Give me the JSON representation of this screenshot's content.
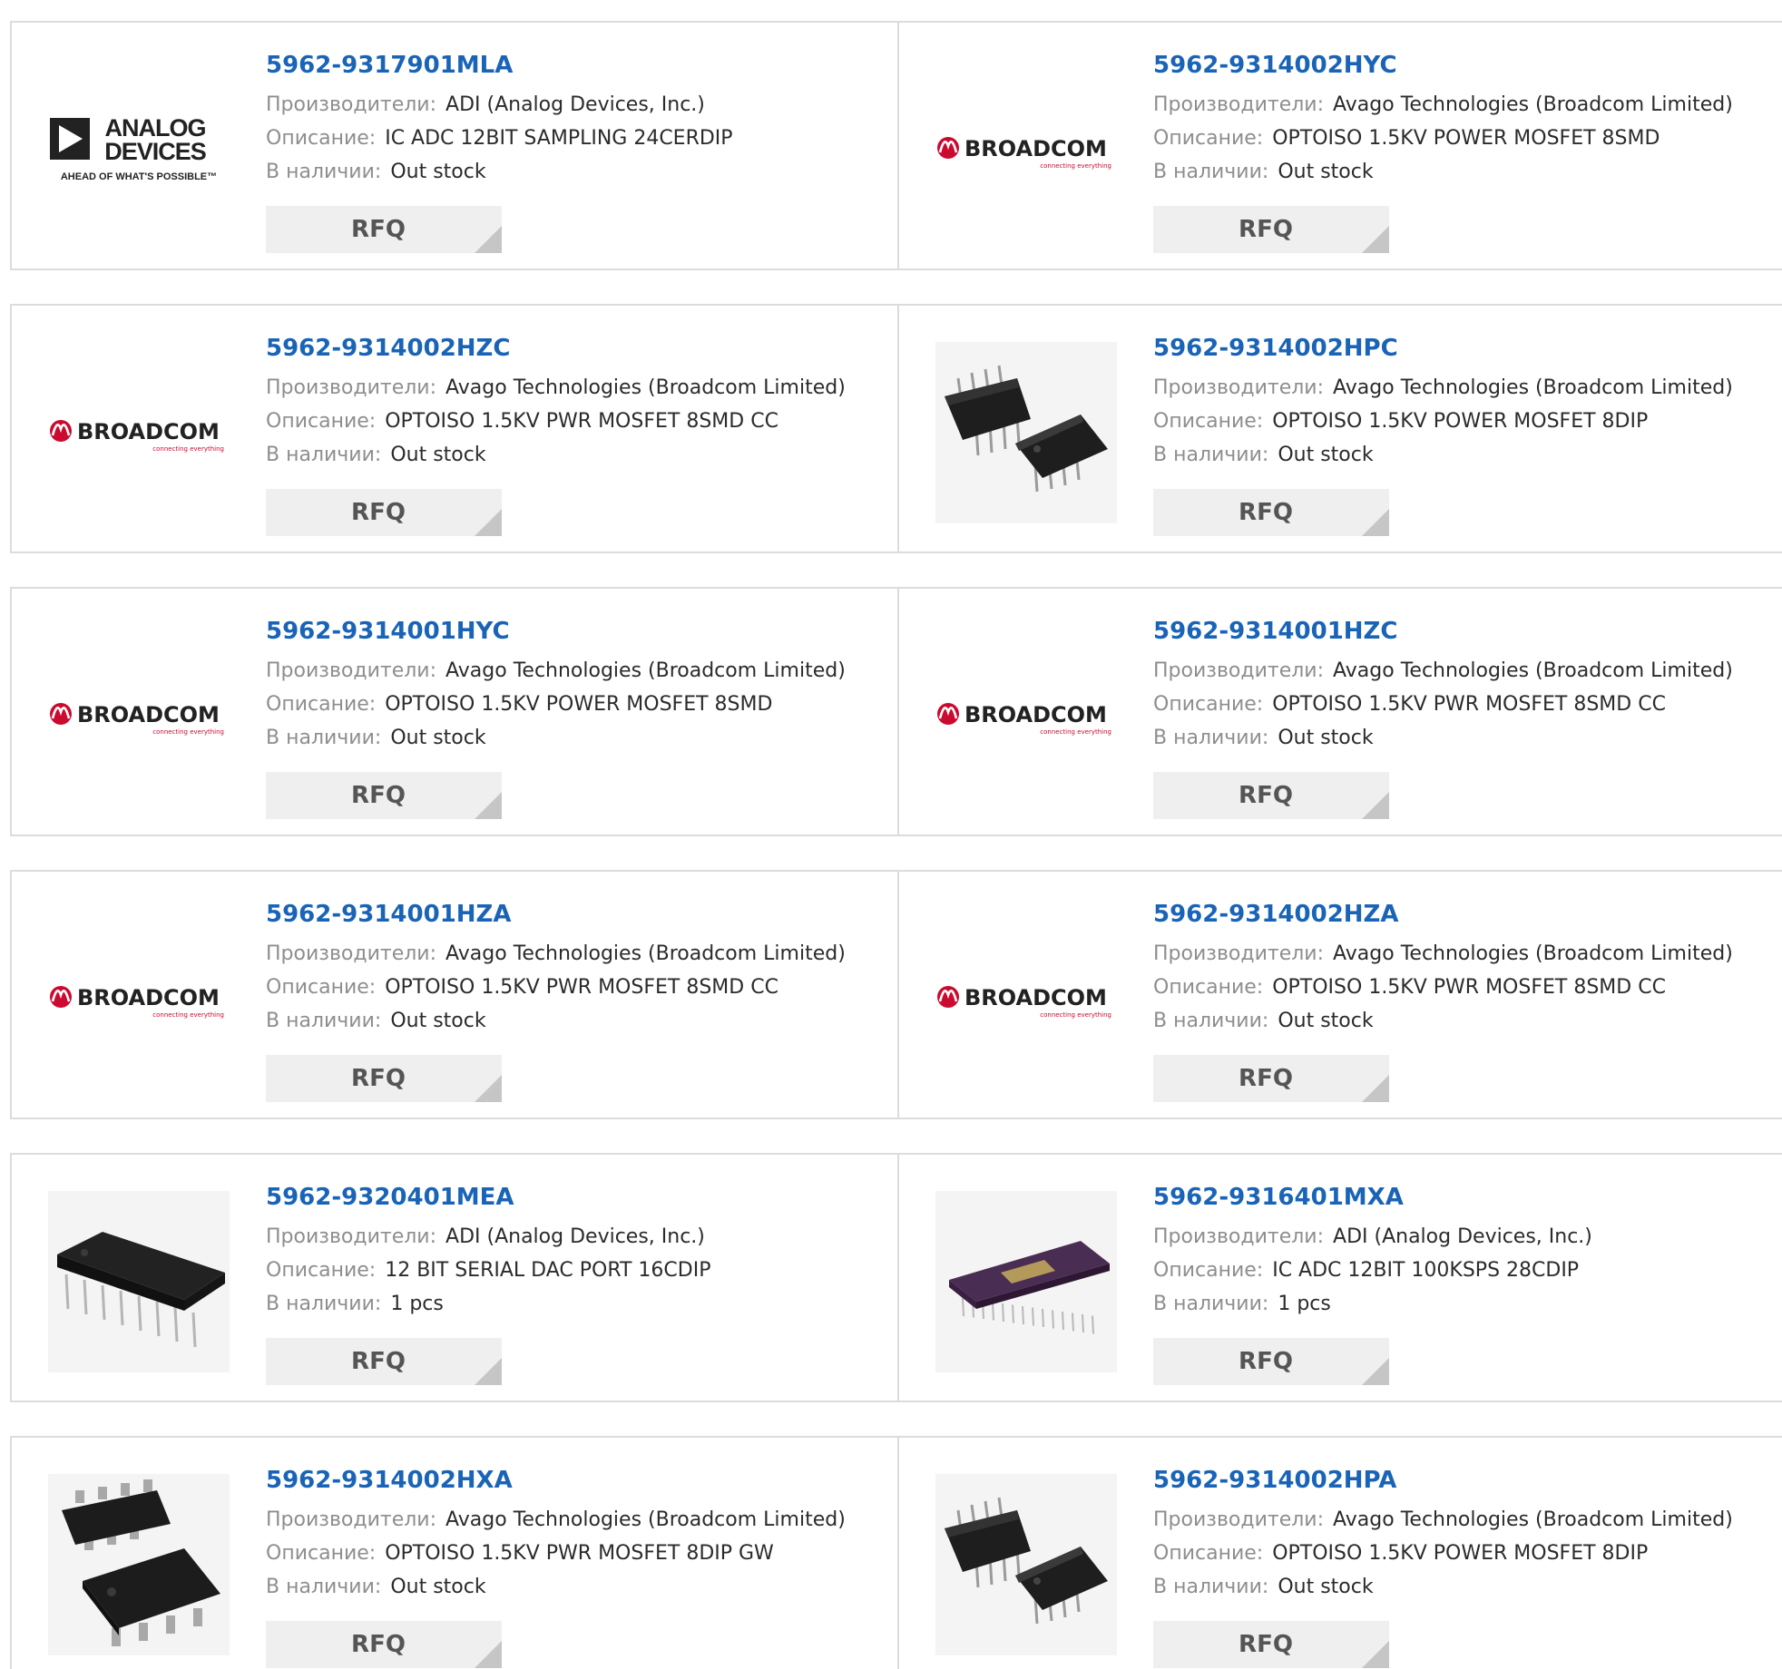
{
  "labels": {
    "manufacturer": "Производители:",
    "description": "Описание:",
    "stock": "В наличии:",
    "rfq": "RFQ"
  },
  "colors": {
    "part_link": "#1a64b7",
    "label": "#8e8e8e",
    "value": "#2b2b2b",
    "border": "#dcdcdc",
    "rfq_bg": "#efefef",
    "broadcom_red": "#cc092f"
  },
  "logos": {
    "adi": {
      "line1": "ANALOG",
      "line2": "DEVICES",
      "tagline": "AHEAD OF WHAT'S POSSIBLE™"
    },
    "broadcom": {
      "name": "BROADCOM",
      "tagline": "connecting everything"
    }
  },
  "products": [
    {
      "part": "5962-9317901MLA",
      "manufacturer": "ADI (Analog Devices, Inc.)",
      "description": "IC ADC 12BIT SAMPLING 24CERDIP",
      "stock": "Out stock",
      "image": "adi-logo"
    },
    {
      "part": "5962-9314002HYC",
      "manufacturer": "Avago Technologies (Broadcom Limited)",
      "description": "OPTOISO 1.5KV POWER MOSFET 8SMD",
      "stock": "Out stock",
      "image": "broadcom-logo"
    },
    {
      "part": "5962-9314002HZC",
      "manufacturer": "Avago Technologies (Broadcom Limited)",
      "description": "OPTOISO 1.5KV PWR MOSFET 8SMD CC",
      "stock": "Out stock",
      "image": "broadcom-logo"
    },
    {
      "part": "5962-9314002HPC",
      "manufacturer": "Avago Technologies (Broadcom Limited)",
      "description": "OPTOISO 1.5KV POWER MOSFET 8DIP",
      "stock": "Out stock",
      "image": "dip8-pair-photo"
    },
    {
      "part": "5962-9314001HYC",
      "manufacturer": "Avago Technologies (Broadcom Limited)",
      "description": "OPTOISO 1.5KV POWER MOSFET 8SMD",
      "stock": "Out stock",
      "image": "broadcom-logo"
    },
    {
      "part": "5962-9314001HZC",
      "manufacturer": "Avago Technologies (Broadcom Limited)",
      "description": "OPTOISO 1.5KV PWR MOSFET 8SMD CC",
      "stock": "Out stock",
      "image": "broadcom-logo"
    },
    {
      "part": "5962-9314001HZA",
      "manufacturer": "Avago Technologies (Broadcom Limited)",
      "description": "OPTOISO 1.5KV PWR MOSFET 8SMD CC",
      "stock": "Out stock",
      "image": "broadcom-logo"
    },
    {
      "part": "5962-9314002HZA",
      "manufacturer": "Avago Technologies (Broadcom Limited)",
      "description": "OPTOISO 1.5KV PWR MOSFET 8SMD CC",
      "stock": "Out stock",
      "image": "broadcom-logo"
    },
    {
      "part": "5962-9320401MEA",
      "manufacturer": "ADI (Analog Devices, Inc.)",
      "description": "12 BIT SERIAL DAC PORT 16CDIP",
      "stock": "1 pcs",
      "image": "dip16-photo"
    },
    {
      "part": "5962-9316401MXA",
      "manufacturer": "ADI (Analog Devices, Inc.)",
      "description": "IC ADC 12BIT 100KSPS 28CDIP",
      "stock": "1 pcs",
      "image": "cerdip28-photo"
    },
    {
      "part": "5962-9314002HXA",
      "manufacturer": "Avago Technologies (Broadcom Limited)",
      "description": "OPTOISO 1.5KV PWR MOSFET 8DIP GW",
      "stock": "Out stock",
      "image": "gullwing-pair-photo"
    },
    {
      "part": "5962-9314002HPA",
      "manufacturer": "Avago Technologies (Broadcom Limited)",
      "description": "OPTOISO 1.5KV POWER MOSFET 8DIP",
      "stock": "Out stock",
      "image": "dip8-pair-photo"
    }
  ]
}
